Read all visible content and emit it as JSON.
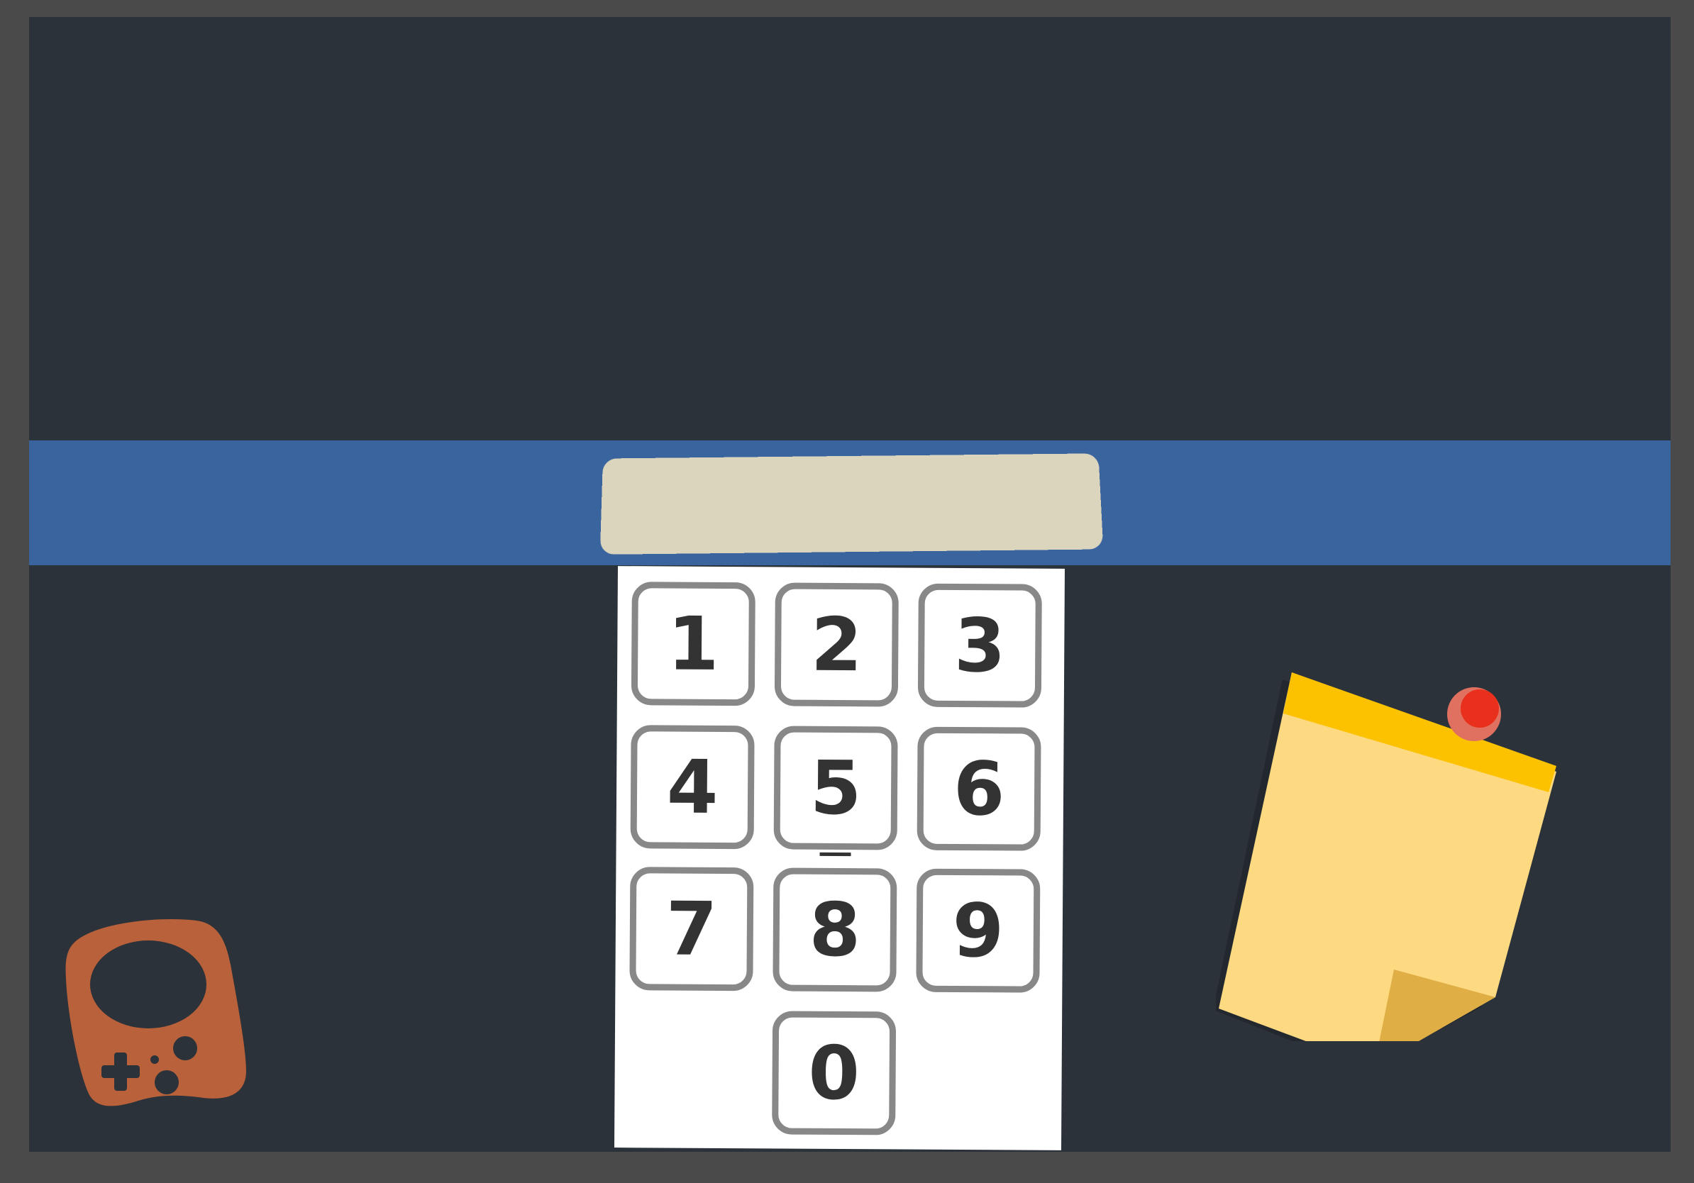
{
  "keypad": {
    "keys": [
      "1",
      "2",
      "3",
      "4",
      "5",
      "6",
      "7",
      "8",
      "9",
      "0"
    ],
    "focused_key": "5"
  },
  "code_display": {
    "value": ""
  },
  "colors": {
    "background": "#2b3239",
    "frame": "#4a4a4a",
    "band": "#3a649e",
    "display": "#dcd5bd",
    "key_border": "#888888",
    "key_text": "#333333",
    "note_paper": "#fdd981",
    "note_tape": "#fcc200",
    "note_fold": "#dfae45",
    "pin": "#e8301c",
    "controller": "#b9613a"
  },
  "icons": {
    "controller": "gamepad-icon",
    "note_pin": "pushpin-icon"
  }
}
